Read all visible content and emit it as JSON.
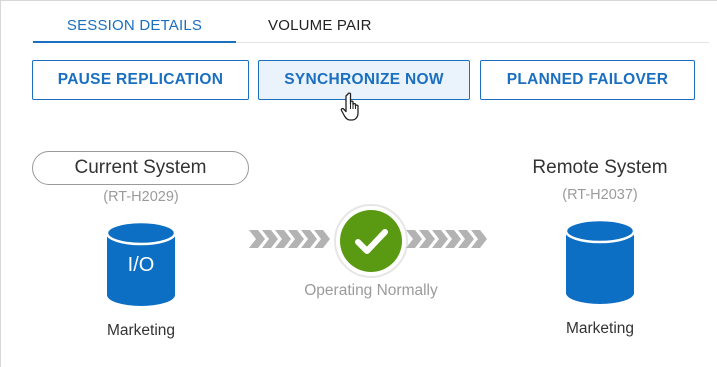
{
  "tabs": [
    {
      "label": "SESSION DETAILS",
      "active": true
    },
    {
      "label": "VOLUME PAIR",
      "active": false
    }
  ],
  "actions": {
    "pause_label": "PAUSE REPLICATION",
    "sync_label": "SYNCHRONIZE NOW",
    "failover_label": "PLANNED FAILOVER"
  },
  "current_system": {
    "title": "Current System",
    "id": "(RT-H2029)",
    "io_label": "I/O",
    "volume": "Marketing"
  },
  "remote_system": {
    "title": "Remote System",
    "id": "(RT-H2037)",
    "volume": "Marketing"
  },
  "replication": {
    "status": "Operating Normally",
    "status_icon": "check-circle-icon"
  },
  "colors": {
    "accent": "#1a6fc0",
    "database": "#0c6fc4",
    "status_ok": "#5a9a12"
  }
}
